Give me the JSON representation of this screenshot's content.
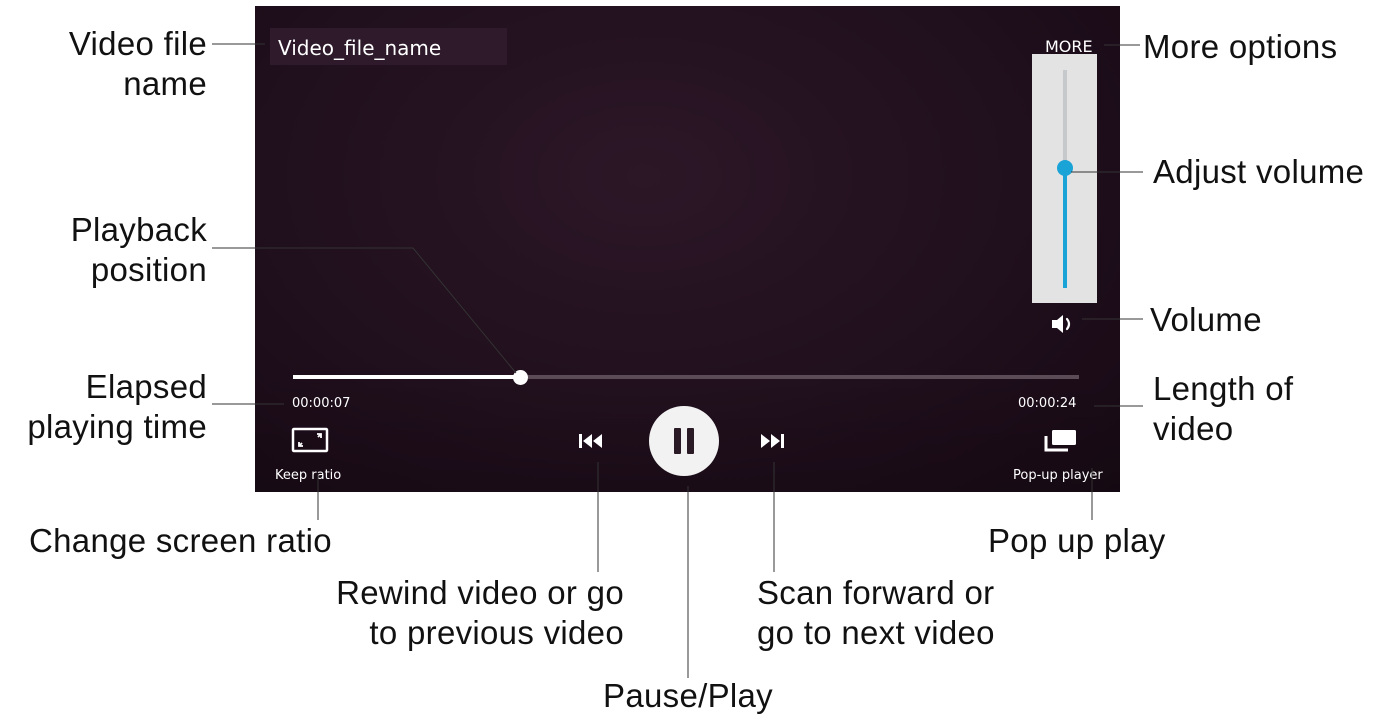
{
  "player": {
    "file_name": "Video_file_name",
    "more_label": "MORE",
    "elapsed_time": "00:00:07",
    "total_time": "00:00:24",
    "progress_fraction": 0.29,
    "volume_fraction": 0.55,
    "keep_ratio_label": "Keep ratio",
    "popup_label": "Pop-up player",
    "accent_color": "#1aa3d6",
    "icons": {
      "keep_ratio": "keep-ratio-icon",
      "previous": "skip-previous-icon",
      "pause": "pause-icon",
      "next": "skip-next-icon",
      "popup": "popup-player-icon",
      "volume": "speaker-icon"
    }
  },
  "callouts": {
    "video_file_name": [
      "Video file",
      "name"
    ],
    "playback_position": [
      "Playback",
      "position"
    ],
    "elapsed_playing_time": [
      "Elapsed",
      "playing time"
    ],
    "change_screen_ratio": "Change screen ratio",
    "rewind": [
      "Rewind video or go",
      "to previous video"
    ],
    "pause_play": "Pause/Play",
    "scan_forward": [
      "Scan forward or",
      "go to next video"
    ],
    "pop_up_play": "Pop up play",
    "length_of_video": [
      "Length of",
      "video"
    ],
    "volume": "Volume",
    "adjust_volume": "Adjust volume",
    "more_options": "More options"
  }
}
